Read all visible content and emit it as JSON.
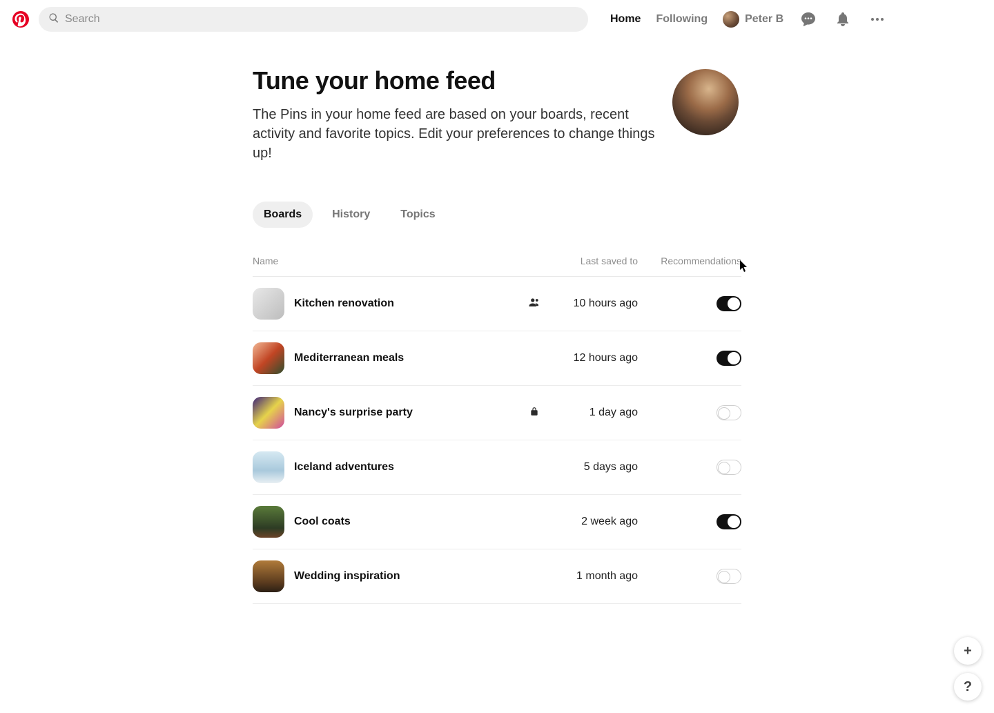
{
  "header": {
    "search_placeholder": "Search",
    "nav": {
      "home": "Home",
      "following": "Following"
    },
    "user_name": "Peter B"
  },
  "main": {
    "title": "Tune your home feed",
    "description": "The Pins in your home feed are based on your boards, recent activity and favorite topics. Edit your preferences to change things up!"
  },
  "tabs": [
    {
      "label": "Boards",
      "active": true
    },
    {
      "label": "History",
      "active": false
    },
    {
      "label": "Topics",
      "active": false
    }
  ],
  "columns": {
    "name": "Name",
    "last_saved": "Last saved to",
    "recommendations": "Recommendations"
  },
  "boards": [
    {
      "name": "Kitchen renovation",
      "last_saved": "10 hours ago",
      "badge": "shared",
      "rec_on": true
    },
    {
      "name": "Mediterranean meals",
      "last_saved": "12 hours ago",
      "badge": null,
      "rec_on": true
    },
    {
      "name": "Nancy's surprise party",
      "last_saved": "1 day ago",
      "badge": "private",
      "rec_on": false
    },
    {
      "name": "Iceland adventures",
      "last_saved": "5 days ago",
      "badge": null,
      "rec_on": false
    },
    {
      "name": "Cool coats",
      "last_saved": "2 week ago",
      "badge": null,
      "rec_on": true
    },
    {
      "name": "Wedding inspiration",
      "last_saved": "1 month ago",
      "badge": null,
      "rec_on": false
    }
  ],
  "fab": {
    "add": "+",
    "help": "?"
  }
}
